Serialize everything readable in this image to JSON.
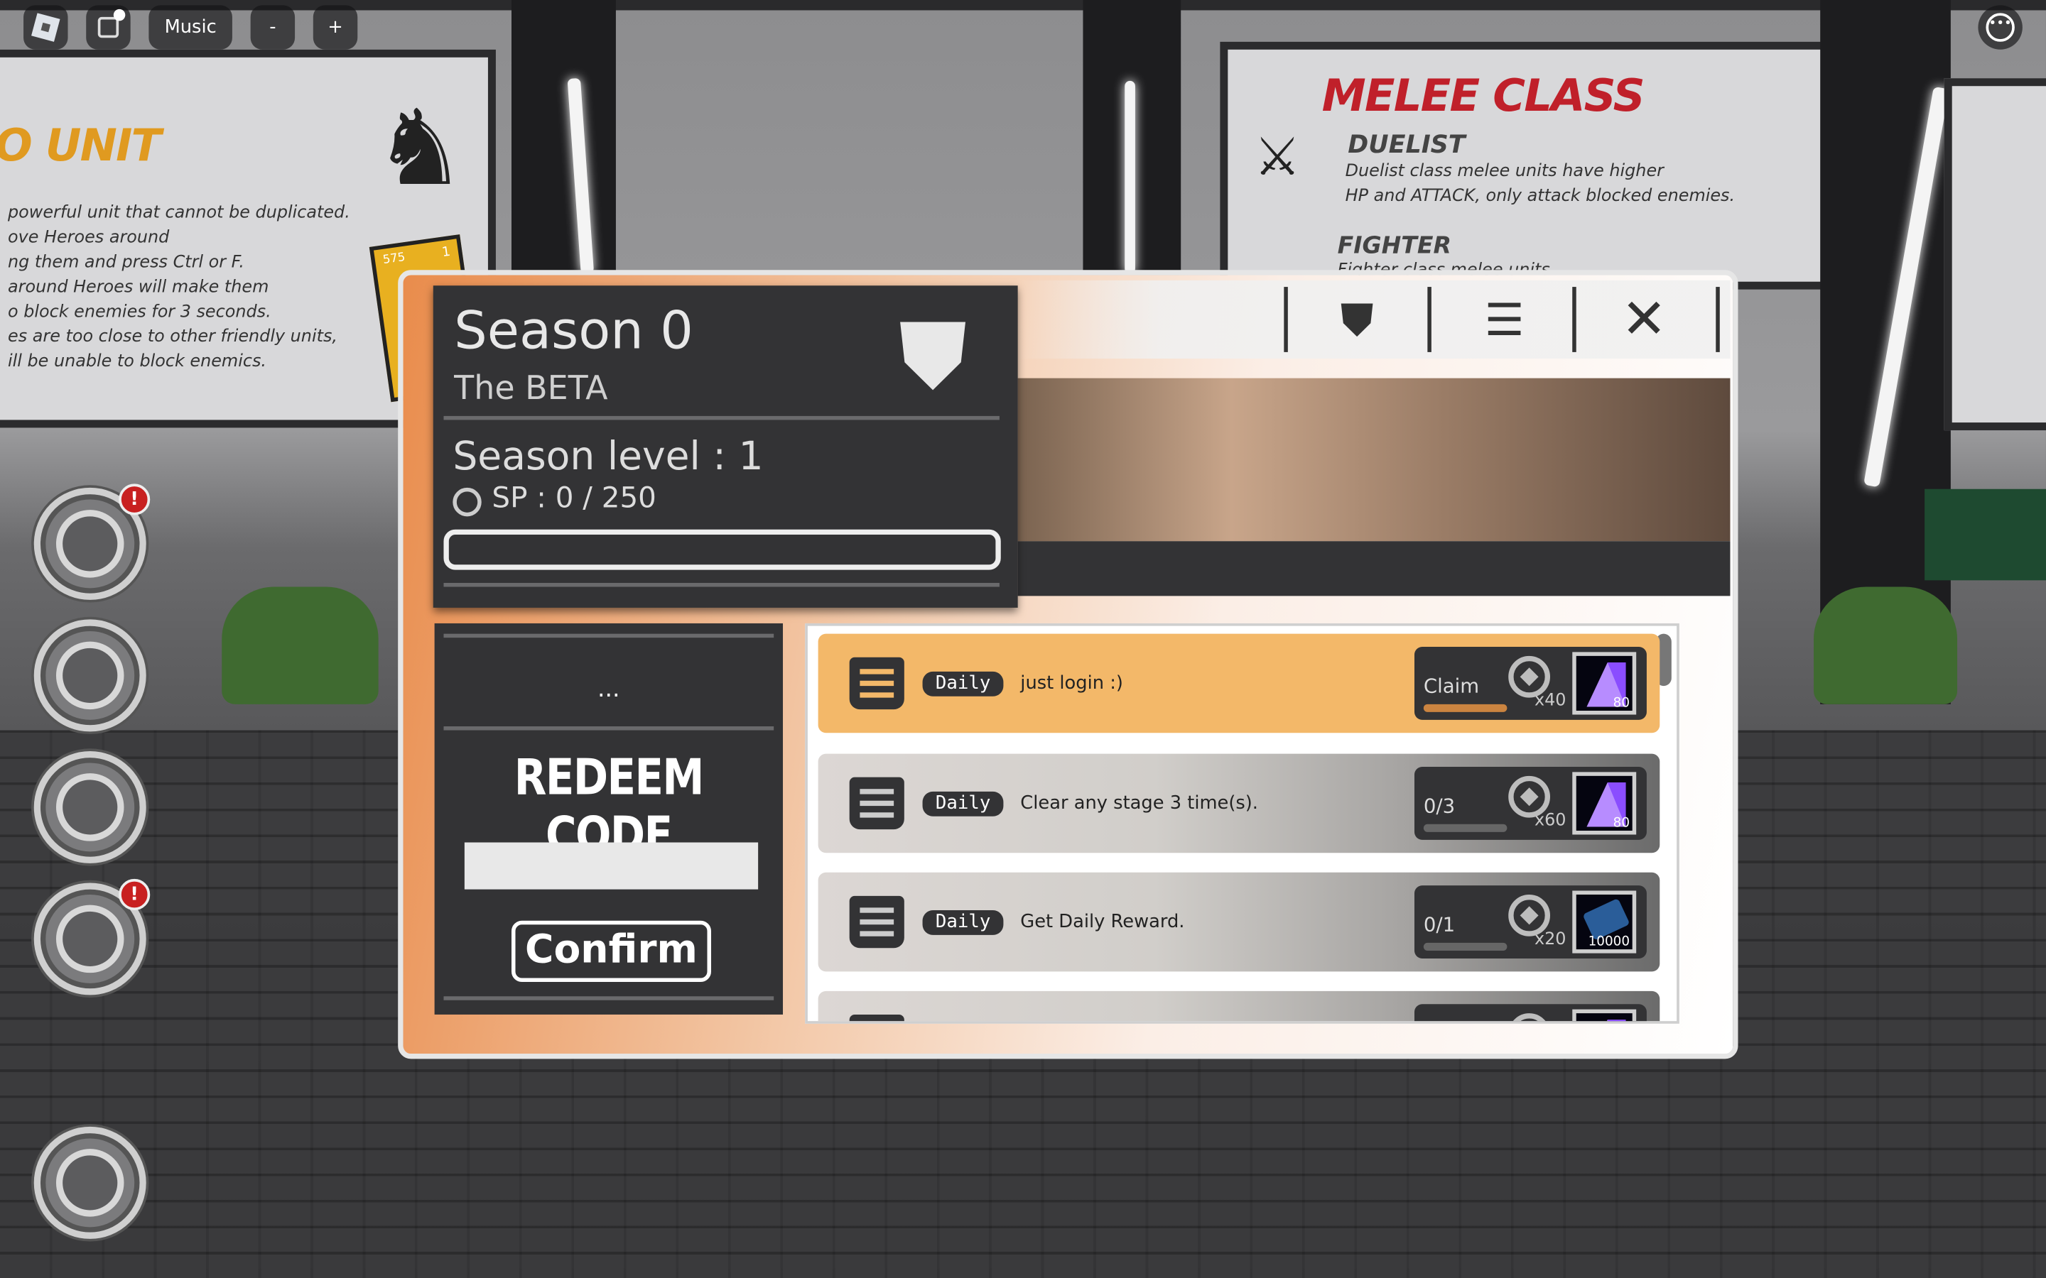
{
  "topbar": {
    "music_label": "Music",
    "minus_label": "-",
    "plus_label": "+"
  },
  "background": {
    "left_sign": {
      "title": "O UNIT",
      "lines": [
        "powerful unit that cannot be duplicated.",
        "ove Heroes around",
        "ng them and press Ctrl or F.",
        "around Heroes will make them",
        "o block enemies for 3 seconds.",
        "es are too close to other friendly units,",
        "ill be unable to block enemics."
      ],
      "card_value": "575",
      "card_count": "1"
    },
    "right_sign": {
      "title": "MELEE CLASS",
      "duelist_title": "DUELIST",
      "duelist_text_1": "Duelist class melee units have higher",
      "duelist_text_2": "HP and ATTACK, only attack blocked enemies.",
      "fighter_title": "FIGHTER",
      "fighter_text": "Fighter class melee units"
    }
  },
  "sidebar": {
    "badges": [
      "!",
      "!"
    ]
  },
  "season": {
    "title": "Season 0",
    "subtitle": "The BETA",
    "level_label": "Season level : 1",
    "sp_label": "SP : 0 / 250",
    "sp_progress": 0
  },
  "redeem": {
    "dots": "...",
    "title": "REDEEM CODE",
    "input_value": "",
    "input_placeholder": "",
    "confirm_label": "Confirm"
  },
  "quests": [
    {
      "tag": "Daily",
      "desc": "just login :)",
      "status": "Claim",
      "multiplier": "x40",
      "item_count": "80",
      "item": "gem",
      "claimable": true
    },
    {
      "tag": "Daily",
      "desc": "Clear any stage 3 time(s).",
      "status": "0/3",
      "multiplier": "x60",
      "item_count": "80",
      "item": "gem",
      "claimable": false
    },
    {
      "tag": "Daily",
      "desc": "Get Daily Reward.",
      "status": "0/1",
      "multiplier": "x20",
      "item_count": "10000",
      "item": "card",
      "claimable": false
    }
  ],
  "colors": {
    "panel_dark": "#333335",
    "claim_row": "#f3b869",
    "claim_bar": "#cb8440",
    "badge": "#c82020"
  }
}
